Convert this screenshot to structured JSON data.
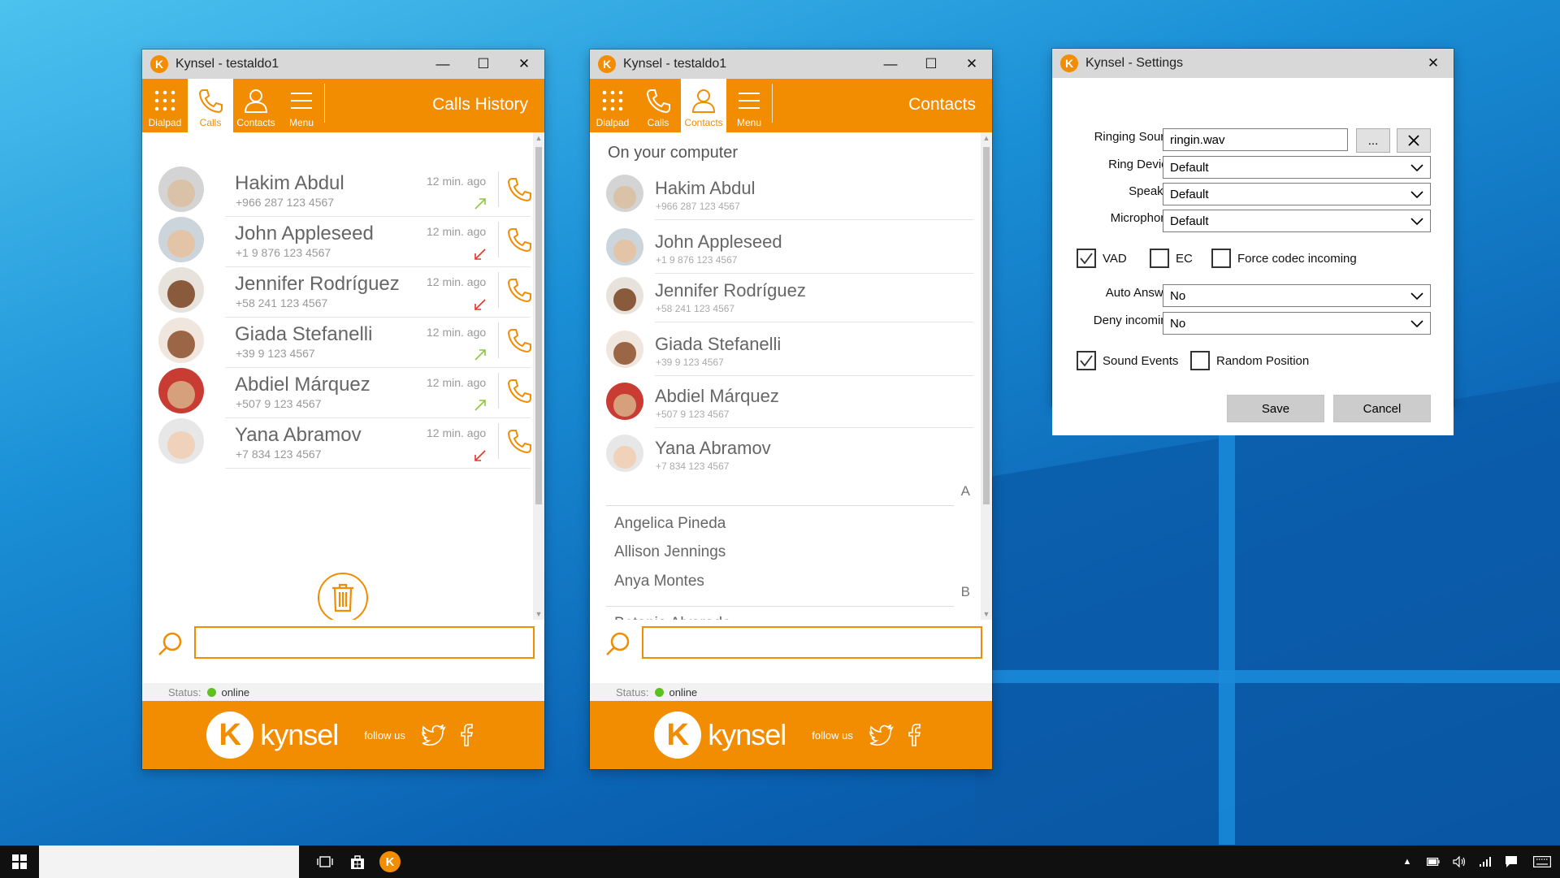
{
  "colors": {
    "brand": "#f28c00",
    "online": "#5dc21e",
    "incoming": "#8cc63f",
    "missed": "#e5352a"
  },
  "nav": [
    {
      "label": "Dialpad",
      "icon": "dialpad-icon"
    },
    {
      "label": "Calls",
      "icon": "phone-icon"
    },
    {
      "label": "Contacts",
      "icon": "user-icon"
    },
    {
      "label": "Menu",
      "icon": "menu-icon"
    }
  ],
  "calls_window": {
    "title": "Kynsel - testaldo1",
    "section": "Calls History",
    "calls": [
      {
        "name": "Hakim Abdul",
        "number": "+966 287 123 4567",
        "time": "12 min. ago",
        "direction": "incoming"
      },
      {
        "name": "John Appleseed",
        "number": "+1 9 876 123 4567",
        "time": "12 min. ago",
        "direction": "missed"
      },
      {
        "name": "Jennifer Rodríguez",
        "number": "+58 241 123 4567",
        "time": "12 min. ago",
        "direction": "missed"
      },
      {
        "name": "Giada Stefanelli",
        "number": "+39 9 123 4567",
        "time": "12 min. ago",
        "direction": "incoming"
      },
      {
        "name": "Abdiel Márquez",
        "number": "+507 9 123 4567",
        "time": "12 min. ago",
        "direction": "incoming"
      },
      {
        "name": "Yana Abramov",
        "number": "+7 834 123 4567",
        "time": "12 min. ago",
        "direction": "missed"
      }
    ],
    "status_label": "Status:",
    "status_value": "online"
  },
  "contacts_window": {
    "title": "Kynsel - testaldo1",
    "section": "Contacts",
    "heading": "On your computer",
    "computer_contacts": [
      {
        "name": "Hakim Abdul",
        "number": "+966 287 123 4567"
      },
      {
        "name": "John Appleseed",
        "number": "+1 9 876 123 4567"
      },
      {
        "name": "Jennifer Rodríguez",
        "number": "+58 241 123 4567"
      },
      {
        "name": "Giada Stefanelli",
        "number": "+39 9 123 4567"
      },
      {
        "name": "Abdiel Márquez",
        "number": "+507 9 123 4567"
      },
      {
        "name": "Yana Abramov",
        "number": "+7 834 123 4567"
      }
    ],
    "letter_a": "A",
    "a_contacts": [
      "Angelica Pineda",
      "Allison Jennings",
      "Anya Montes"
    ],
    "letter_b": "B",
    "b_contacts": [
      "Betania Alvarado"
    ],
    "status_label": "Status:",
    "status_value": "online"
  },
  "footer": {
    "brand": "kynsel",
    "follow": "follow us"
  },
  "settings": {
    "title": "Kynsel - Settings",
    "ringing_sound_label": "Ringing Sound",
    "ringing_sound_value": "ringin.wav",
    "browse_label": "...",
    "ring_device_label": "Ring Device",
    "ring_device_value": "Default",
    "speaker_label": "Speaker",
    "speaker_value": "Default",
    "microphone_label": "Microphone",
    "microphone_value": "Default",
    "vad_label": "VAD",
    "vad_checked": true,
    "ec_label": "EC",
    "ec_checked": false,
    "force_codec_label": "Force codec incoming",
    "force_codec_checked": false,
    "auto_answer_label": "Auto Answer",
    "auto_answer_value": "No",
    "deny_incoming_label": "Deny incoming",
    "deny_incoming_value": "No",
    "sound_events_label": "Sound Events",
    "sound_events_checked": true,
    "random_position_label": "Random Position",
    "random_position_checked": false,
    "save_label": "Save",
    "cancel_label": "Cancel"
  }
}
